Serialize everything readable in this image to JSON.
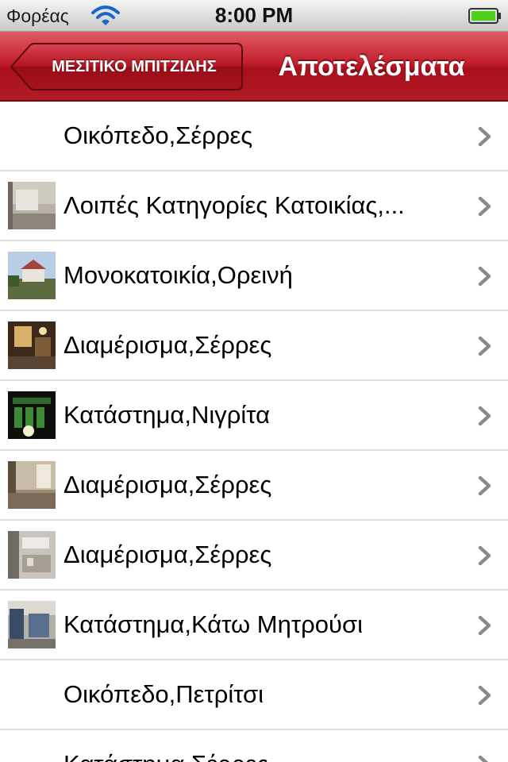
{
  "status_bar": {
    "carrier": "Φορέας",
    "time": "8:00 PM"
  },
  "nav": {
    "back_label": "ΜΕΣΙΤΙΚΟ ΜΠΙΤΖΙΔΗΣ",
    "title": "Αποτελέσματα"
  },
  "results": [
    {
      "label": "Οικόπεδο,Σέρρες",
      "thumbnail": "none"
    },
    {
      "label": "Λοιπές Κατηγορίες Κατοικίας,...",
      "thumbnail": "room-photo"
    },
    {
      "label": "Μονοκατοικία,Ορεινή",
      "thumbnail": "house-photo"
    },
    {
      "label": "Διαμέρισμα,Σέρρες",
      "thumbnail": "interior-photo"
    },
    {
      "label": "Κατάστημα,Νιγρίτα",
      "thumbnail": "storefront-photo"
    },
    {
      "label": "Διαμέρισμα,Σέρρες",
      "thumbnail": "room-photo"
    },
    {
      "label": "Διαμέρισμα,Σέρρες",
      "thumbnail": "kitchen-photo"
    },
    {
      "label": "Κατάστημα,Κάτω Μητρούσι",
      "thumbnail": "shop-photo"
    },
    {
      "label": "Οικόπεδο,Πετρίτσι",
      "thumbnail": "none"
    },
    {
      "label": "Κατάστημα,Σέρρες",
      "thumbnail": "none"
    }
  ],
  "colors": {
    "nav_red": "#c3202d",
    "chevron_gray": "#8a8a8a",
    "battery_green": "#4cd01c"
  }
}
